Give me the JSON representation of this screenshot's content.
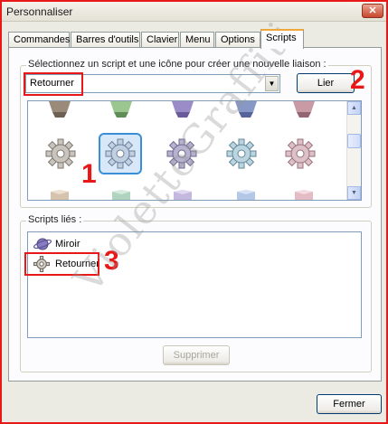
{
  "window": {
    "title": "Personnaliser",
    "close_glyph": "✕"
  },
  "tabs": [
    {
      "label": "Commandes",
      "active": false
    },
    {
      "label": "Barres d'outils",
      "active": false
    },
    {
      "label": "Clavier",
      "active": false
    },
    {
      "label": "Menu",
      "active": false
    },
    {
      "label": "Options",
      "active": false
    },
    {
      "label": "Scripts",
      "active": true
    }
  ],
  "select_group": {
    "label": "Sélectionnez un script et une icône pour créer une nouvelle liaison :",
    "combo_value": "Retourner",
    "link_button": "Lier"
  },
  "icon_grid": {
    "icons_top": [
      "cube-brown-icon",
      "cube-green-icon",
      "cube-purple-icon",
      "cube-blue-icon",
      "cube-pink-icon"
    ],
    "icons_middle": [
      "gear-grey-icon",
      "gear-blue-icon",
      "gear-purple-icon",
      "gear-cyan-icon",
      "gear-pink-icon"
    ],
    "icons_bottom": [
      "cube-tan-icon",
      "cube-teal-icon",
      "cube-lilac-icon",
      "cube-lightblue-icon",
      "cube-rose-icon"
    ],
    "selected_index": 1
  },
  "linked_group": {
    "label": "Scripts liés :",
    "items": [
      {
        "label": "Miroir",
        "icon": "planet-icon"
      },
      {
        "label": "Retourner",
        "icon": "gear-icon"
      }
    ],
    "delete_button": "Supprimer"
  },
  "close_button": "Fermer",
  "annotations": {
    "one": "1",
    "two": "2",
    "three": "3"
  },
  "watermark": "VioletteGraffiti",
  "colors": {
    "annotation_red": "#e81818",
    "tab_accent": "#f1a63a",
    "selection_blue": "#3a8fd8"
  }
}
